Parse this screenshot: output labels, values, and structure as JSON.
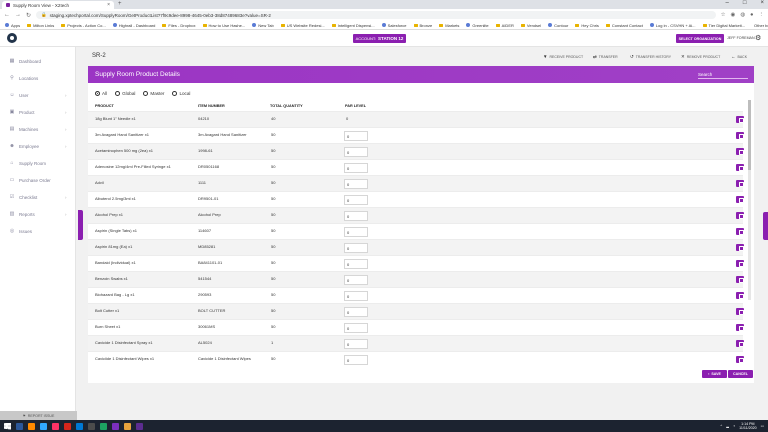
{
  "browser": {
    "tab_title": "Supply Room View - X2tech",
    "url": "staging.xptechportal.com/SupplyRoom/GetProductList?7f9c9dee-8998-4645-0eb3-38d87489683e?value=SR-2",
    "bookmarks": [
      "Apps",
      "Milton Links",
      "Projects - Action Co...",
      "Highrall - Dashboard",
      "Files - Dropbox",
      "How to Use Hashe...",
      "New Tab",
      "US Website Redesi...",
      "Intelligent Dispensi...",
      "Salesforce",
      "Bronze",
      "Markets",
      "Greenlite",
      "AIDER",
      "Vendsel",
      "Contour",
      "Hey Chris",
      "Constant Contact",
      "Log in - CSVHN + Ai...",
      "Tier Digital Marketi..."
    ],
    "other_bookmarks": "Other bookmarks"
  },
  "header": {
    "account_label": "ACCOUNT:",
    "account_value": "STATION 12",
    "select_org": "SELECT ORGANIZATION",
    "user": "JEFF FOREMAN"
  },
  "sidebar": {
    "items": [
      {
        "label": "Dashboard",
        "icon": "grid-icon",
        "glyph": "▦",
        "arrow": false
      },
      {
        "label": "Locations",
        "icon": "pin-icon",
        "glyph": "⚲",
        "arrow": false
      },
      {
        "label": "User",
        "icon": "user-icon",
        "glyph": "☺",
        "arrow": true
      },
      {
        "label": "Product",
        "icon": "box-icon",
        "glyph": "▣",
        "arrow": true
      },
      {
        "label": "Machines",
        "icon": "machine-icon",
        "glyph": "▤",
        "arrow": true
      },
      {
        "label": "Employee",
        "icon": "employee-icon",
        "glyph": "☻",
        "arrow": true
      },
      {
        "label": "Supply Room",
        "icon": "store-icon",
        "glyph": "⌂",
        "arrow": false
      },
      {
        "label": "Purchase Order",
        "icon": "cart-icon",
        "glyph": "▭",
        "arrow": false
      },
      {
        "label": "Checklist",
        "icon": "checklist-icon",
        "glyph": "☑",
        "arrow": true
      },
      {
        "label": "Reports",
        "icon": "chart-icon",
        "glyph": "▥",
        "arrow": true
      },
      {
        "label": "Issues",
        "icon": "issue-icon",
        "glyph": "◎",
        "arrow": false
      }
    ],
    "report_issue": "REPORT ISSUE"
  },
  "page": {
    "title": "SR-2",
    "actions": {
      "receive": "RECEIVE PRODUCT",
      "transfer": "TRANSFER",
      "history": "TRANSFER HISTORY",
      "remove": "REMOVE PRODUCT",
      "back": "BACK"
    },
    "panel_title": "Supply Room Product Details",
    "search_placeholder": "Search",
    "filters": [
      "All",
      "Global",
      "Master",
      "Local"
    ],
    "selected_filter": "All",
    "columns": [
      "PRODUCT",
      "ITEM NUMBER",
      "TOTAL QUANTITY",
      "PAR LEVEL"
    ],
    "rows": [
      {
        "product": "18g Blunt 1\" Needle x1",
        "item": "04210",
        "qty": "40",
        "par": "0"
      },
      {
        "product": "3m Avagard Hand Sanitizer x1",
        "item": "3m Avagard Hand Sanitizer",
        "qty": "50",
        "par": "0"
      },
      {
        "product": "Acetaminophen 500 mg (2ea) x1",
        "item": "1998-61",
        "qty": "50",
        "par": "0"
      },
      {
        "product": "Adenosine 12mg/4ml Pre-Filled Syringe x1",
        "item": "DR0501168",
        "qty": "50",
        "par": "0"
      },
      {
        "product": "Advil",
        "item": "1111",
        "qty": "50",
        "par": "0"
      },
      {
        "product": "Albuterol 2.5mg/3ml x1",
        "item": "DR9501-01",
        "qty": "50",
        "par": "0"
      },
      {
        "product": "Alcohol Prep x1",
        "item": "Alcohol Prep",
        "qty": "50",
        "par": "0"
      },
      {
        "product": "Aspirin (Single Tabs) x1",
        "item": "114607",
        "qty": "50",
        "par": "0"
      },
      {
        "product": "Aspirin 81mg (Ea) x1",
        "item": "MD85281",
        "qty": "50",
        "par": "0"
      },
      {
        "product": "Bandaid (Individual) x1",
        "item": "BA841101-01",
        "qty": "50",
        "par": "0"
      },
      {
        "product": "Benzoin Swabs x1",
        "item": "541544",
        "qty": "50",
        "par": "0"
      },
      {
        "product": "Biohazard Bag - Lg x1",
        "item": "290593",
        "qty": "50",
        "par": "0"
      },
      {
        "product": "Bolt Cutter x1",
        "item": "BOLT CUTTER",
        "qty": "50",
        "par": "0"
      },
      {
        "product": "Burn Sheet x1",
        "item": "30061MS",
        "qty": "50",
        "par": "0"
      },
      {
        "product": "Cavicide 1 Disinfectant Spray x1",
        "item": "AL5024",
        "qty": "1",
        "par": "0"
      },
      {
        "product": "Caviciide 1 Disinfectant Wipes x1",
        "item": "Cavicide 1 Disinfectant Wipes",
        "qty": "50",
        "par": "0"
      }
    ],
    "save": "SAVE",
    "cancel": "CANCEL"
  },
  "taskbar": {
    "time": "1:14 PM",
    "date": "11/11/2020"
  },
  "colors": {
    "accent": "#8b1fb0",
    "header_gradient": "#9b35c4"
  }
}
